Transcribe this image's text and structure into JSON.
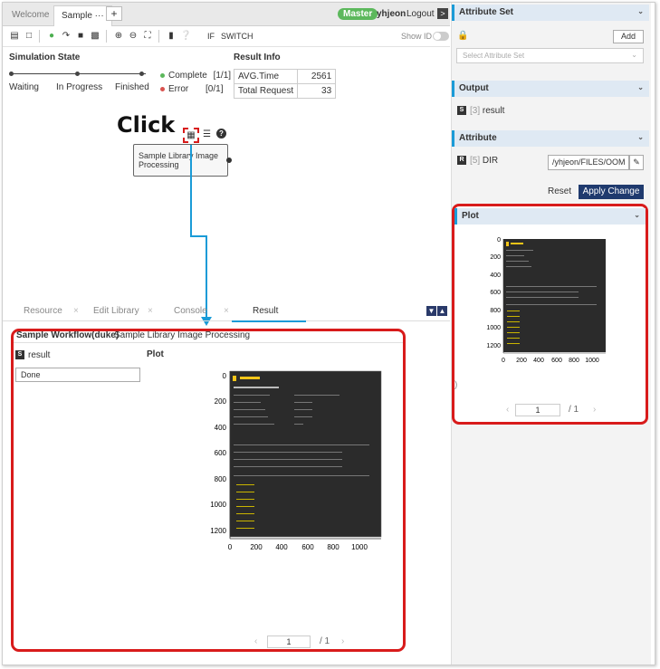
{
  "tabs": {
    "welcome": "Welcome",
    "sample": "Sample ···",
    "add": "+"
  },
  "header": {
    "master": "Master",
    "user": "yhjeon",
    "logout": "Logout",
    "exit": ">"
  },
  "toolbar": {
    "if": "IF",
    "switch": "SWITCH",
    "show_id": "Show ID"
  },
  "simulation": {
    "title": "Simulation State",
    "states": [
      "Waiting",
      "In Progress",
      "Finished"
    ],
    "complete_label": "Complete",
    "complete_value": "[1/1]",
    "error_label": "Error",
    "error_value": "[0/1]"
  },
  "result_info": {
    "title": "Result Info",
    "rows": [
      {
        "label": "AVG.Time",
        "value": "2561"
      },
      {
        "label": "Total Request",
        "value": "33"
      }
    ]
  },
  "canvas": {
    "click_label": "Click",
    "node_label": "Sample Library Image Processing"
  },
  "bottom_tabs": [
    "Resource",
    "Edit Library",
    "Console",
    "Result"
  ],
  "result_panel": {
    "workflow": "Sample Workflow(duke)",
    "node": "Sample Library Image Processing",
    "output_badge": "S",
    "output_name": "result",
    "output_value": "Done",
    "plot_label": "Plot",
    "page": "1",
    "page_total": "/ 1"
  },
  "plot_axes": {
    "y_ticks": [
      "0",
      "200",
      "400",
      "600",
      "800",
      "1000",
      "1200"
    ],
    "x_ticks": [
      "0",
      "200",
      "400",
      "600",
      "800",
      "1000"
    ]
  },
  "attribute_set": {
    "title": "Attribute Set",
    "add": "Add",
    "placeholder": "Select Attribute Set"
  },
  "output": {
    "title": "Output",
    "badge": "S",
    "index": "[3]",
    "name": "result"
  },
  "attribute": {
    "title": "Attribute",
    "badge": "R",
    "index": "[5]",
    "name": "DIR",
    "value": "/yhjeon/FILES/OOM"
  },
  "actions": {
    "reset": "Reset",
    "apply": "Apply Change"
  },
  "plot_panel": {
    "title": "Plot",
    "page": "1",
    "page_total": "/ 1",
    "paren": ")"
  },
  "colors": {
    "accent": "#1a9bd7",
    "highlight": "#d81b1b",
    "complete": "#5cb85c",
    "error": "#d9534f",
    "apply": "#1f3a6e"
  }
}
